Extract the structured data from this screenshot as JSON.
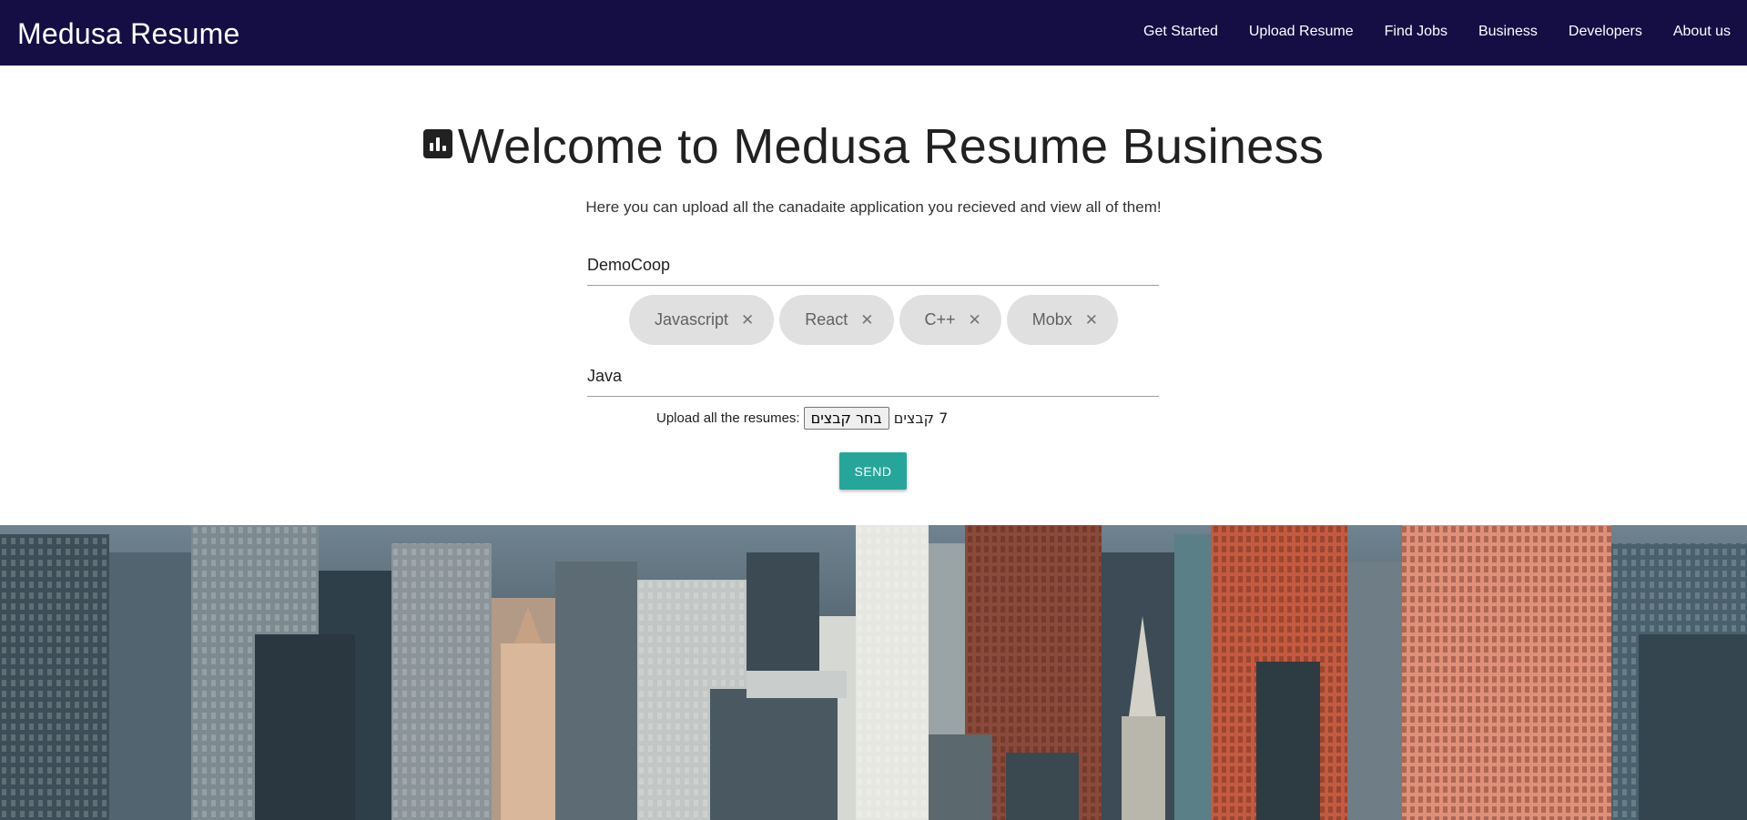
{
  "navbar": {
    "brand": "Medusa Resume",
    "links": [
      "Get Started",
      "Upload Resume",
      "Find Jobs",
      "Business",
      "Developers",
      "About us"
    ]
  },
  "hero": {
    "icon": "bar-chart-icon",
    "title": "Welcome to Medusa Resume Business",
    "subtitle": "Here you can upload all the canadaite application you recieved and view all of them!"
  },
  "form": {
    "company_value": "DemoCoop",
    "skills": [
      "Javascript",
      "React",
      "C++",
      "Mobx"
    ],
    "skill_input_value": "Java",
    "upload_label": "Upload all the resumes:",
    "file_button_label": "בחר קבצים",
    "file_status": "7 קבצים",
    "send_label": "SEND"
  },
  "colors": {
    "navbar_bg": "#140e45",
    "accent": "#26a69a",
    "chip_bg": "#e0e0e0"
  },
  "background_image": {
    "icon": "city-skyline-image"
  }
}
